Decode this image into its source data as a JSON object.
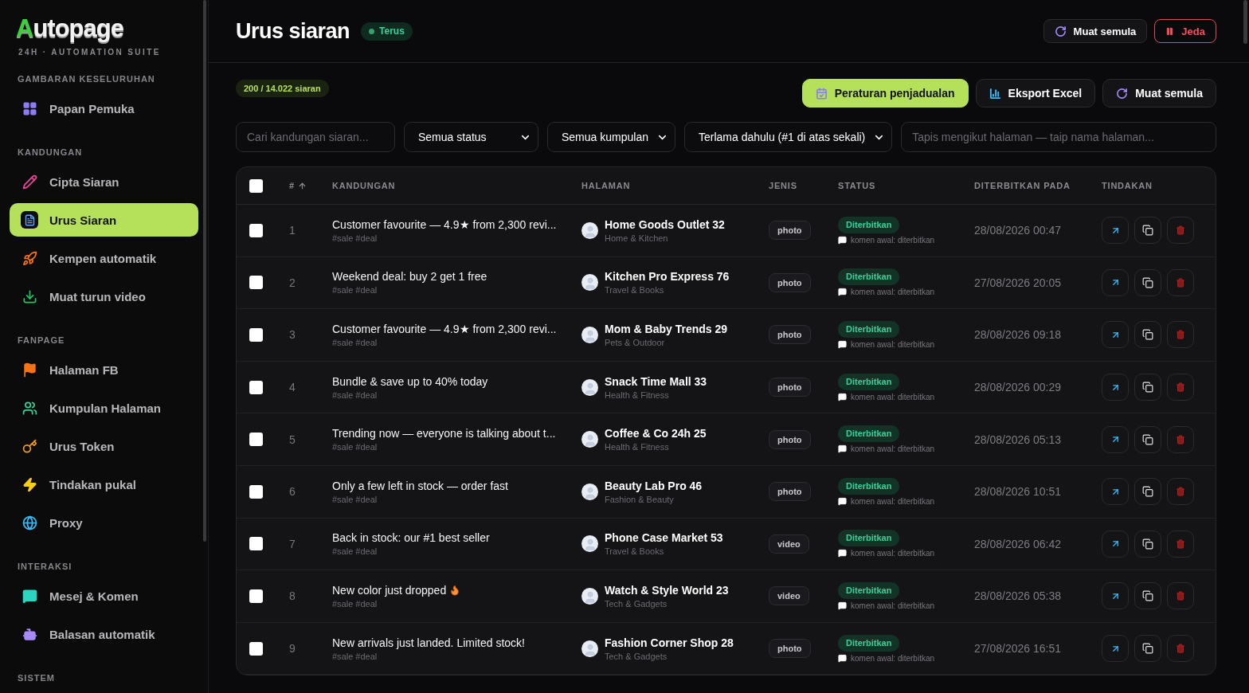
{
  "brand": {
    "logo": "Autopage",
    "tagline": "24H · AUTOMATION SUITE"
  },
  "sidebar": {
    "sections": [
      {
        "title": "GAMBARAN KESELURUHAN",
        "items": [
          {
            "label": "Papan Pemuka",
            "selected": false
          }
        ]
      },
      {
        "title": "KANDUNGAN",
        "items": [
          {
            "label": "Cipta Siaran",
            "selected": false
          },
          {
            "label": "Urus Siaran",
            "selected": true
          },
          {
            "label": "Kempen automatik",
            "selected": false
          },
          {
            "label": "Muat turun video",
            "selected": false
          }
        ]
      },
      {
        "title": "FANPAGE",
        "items": [
          {
            "label": "Halaman FB",
            "selected": false
          },
          {
            "label": "Kumpulan Halaman",
            "selected": false
          },
          {
            "label": "Urus Token",
            "selected": false
          },
          {
            "label": "Tindakan pukal",
            "selected": false
          },
          {
            "label": "Proxy",
            "selected": false
          }
        ]
      },
      {
        "title": "INTERAKSI",
        "items": [
          {
            "label": "Mesej & Komen",
            "selected": false
          },
          {
            "label": "Balasan automatik",
            "selected": false
          }
        ]
      },
      {
        "title": "SISTEM"
      }
    ]
  },
  "header": {
    "title": "Urus siaran",
    "live_badge": "Terus",
    "buttons": [
      {
        "label": "Muat semula",
        "kind": "reload"
      },
      {
        "label": "Jeda",
        "kind": "pause"
      }
    ]
  },
  "toolbar": {
    "count": "200 / 14.022 siaran",
    "buttons": [
      {
        "label": "Peraturan penjadualan",
        "kind": "primary"
      },
      {
        "label": "Eksport Excel",
        "kind": "export"
      },
      {
        "label": "Muat semula",
        "kind": "reload"
      }
    ]
  },
  "filters": {
    "search": {
      "placeholder": "Cari kandungan siaran..."
    },
    "selects": [
      "Semua status",
      "Semua kumpulan",
      "Terlama dahulu (#1 di atas sekali)"
    ],
    "page_filter": {
      "placeholder": "Tapis mengikut halaman — taip nama halaman..."
    }
  },
  "table": {
    "select_all": {
      "checked": false
    },
    "columns": [
      "#",
      "KANDUNGAN",
      "HALAMAN",
      "JENIS",
      "STATUS",
      "DITERBITKAN PADA",
      "TINDAKAN"
    ],
    "rows": [
      {
        "checked": false,
        "no": "1",
        "content": "Customer favourite — 4.9★ from 2,300 revi...",
        "flame": false,
        "tags": "#sale #deal",
        "page": "Home Goods Outlet 32",
        "category": "Home & Kitchen",
        "type": "photo",
        "status": "Diterbitkan",
        "comment": "komen awal: diterbitkan",
        "published": "28/08/2026 00:47"
      },
      {
        "checked": false,
        "no": "2",
        "content": "Weekend deal: buy 2 get 1 free",
        "flame": false,
        "tags": "#sale #deal",
        "page": "Kitchen Pro Express 76",
        "category": "Travel & Books",
        "type": "photo",
        "status": "Diterbitkan",
        "comment": "komen awal: diterbitkan",
        "published": "27/08/2026 20:05"
      },
      {
        "checked": false,
        "no": "3",
        "content": "Customer favourite — 4.9★ from 2,300 revi...",
        "flame": false,
        "tags": "#sale #deal",
        "page": "Mom & Baby Trends 29",
        "category": "Pets & Outdoor",
        "type": "photo",
        "status": "Diterbitkan",
        "comment": "komen awal: diterbitkan",
        "published": "28/08/2026 09:18"
      },
      {
        "checked": false,
        "no": "4",
        "content": "Bundle & save up to 40% today",
        "flame": false,
        "tags": "#sale #deal",
        "page": "Snack Time Mall 33",
        "category": "Health & Fitness",
        "type": "photo",
        "status": "Diterbitkan",
        "comment": "komen awal: diterbitkan",
        "published": "28/08/2026 00:29"
      },
      {
        "checked": false,
        "no": "5",
        "content": "Trending now — everyone is talking about t...",
        "flame": false,
        "tags": "#sale #deal",
        "page": "Coffee & Co 24h 25",
        "category": "Health & Fitness",
        "type": "photo",
        "status": "Diterbitkan",
        "comment": "komen awal: diterbitkan",
        "published": "28/08/2026 05:13"
      },
      {
        "checked": false,
        "no": "6",
        "content": "Only a few left in stock — order fast",
        "flame": false,
        "tags": "#sale #deal",
        "page": "Beauty Lab Pro 46",
        "category": "Fashion & Beauty",
        "type": "photo",
        "status": "Diterbitkan",
        "comment": "komen awal: diterbitkan",
        "published": "28/08/2026 10:51"
      },
      {
        "checked": false,
        "no": "7",
        "content": "Back in stock: our #1 best seller",
        "flame": false,
        "tags": "#sale #deal",
        "page": "Phone Case Market 53",
        "category": "Travel & Books",
        "type": "video",
        "status": "Diterbitkan",
        "comment": "komen awal: diterbitkan",
        "published": "28/08/2026 06:42"
      },
      {
        "checked": false,
        "no": "8",
        "content": "New color just dropped",
        "flame": true,
        "tags": "#sale #deal",
        "page": "Watch & Style World 23",
        "category": "Tech & Gadgets",
        "type": "video",
        "status": "Diterbitkan",
        "comment": "komen awal: diterbitkan",
        "published": "28/08/2026 05:38"
      },
      {
        "checked": false,
        "no": "9",
        "content": "New arrivals just landed. Limited stock!",
        "flame": false,
        "tags": "#sale #deal",
        "page": "Fashion Corner Shop 28",
        "category": "Tech & Gadgets",
        "type": "photo",
        "status": "Diterbitkan",
        "comment": "komen awal: diterbitkan",
        "published": "27/08/2026 16:51"
      }
    ]
  }
}
